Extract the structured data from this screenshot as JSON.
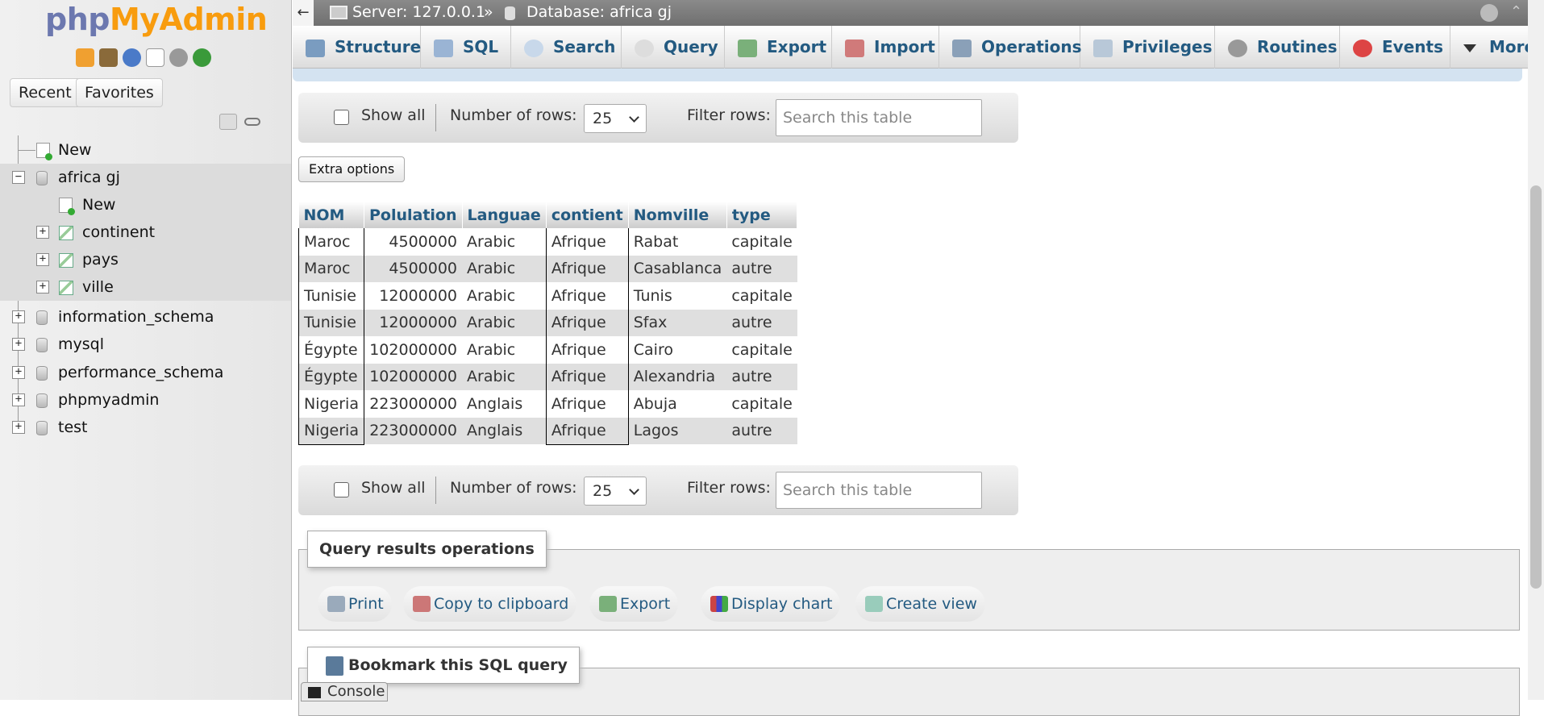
{
  "sidebar": {
    "logo_php": "php",
    "logo_myadmin": "MyAdmin",
    "nav_icons": [
      "home-icon",
      "exit-icon",
      "help-icon",
      "docs-icon",
      "settings-icon",
      "reload-icon"
    ],
    "tabs": {
      "recent": "Recent",
      "favorites": "Favorites"
    },
    "tree": {
      "new_root": "New",
      "db_active": "africa gj",
      "db_new": "New",
      "tables": [
        "continent",
        "pays",
        "ville"
      ],
      "databases": [
        "information_schema",
        "mysql",
        "performance_schema",
        "phpmyadmin",
        "test"
      ]
    }
  },
  "topbar": {
    "back": "←",
    "server_label": "Server: 127.0.0.1",
    "separator": "»",
    "database_label": "Database: africa gj"
  },
  "menu": {
    "tabs": [
      "Structure",
      "SQL",
      "Search",
      "Query",
      "Export",
      "Import",
      "Operations",
      "Privileges",
      "Routines",
      "Events",
      "More"
    ]
  },
  "navigation": {
    "show_all": "Show all",
    "rows_label": "Number of rows:",
    "rows_value": "25",
    "filter_label": "Filter rows:",
    "filter_placeholder": "Search this table"
  },
  "extra_options": "Extra options",
  "table": {
    "columns": [
      "NOM",
      "Polulation",
      "Languae",
      "contient",
      "Nomville",
      "type"
    ],
    "rows": [
      [
        "Maroc",
        "4500000",
        "Arabic",
        "Afrique",
        "Rabat",
        "capitale"
      ],
      [
        "Maroc",
        "4500000",
        "Arabic",
        "Afrique",
        "Casablanca",
        "autre"
      ],
      [
        "Tunisie",
        "12000000",
        "Arabic",
        "Afrique",
        "Tunis",
        "capitale"
      ],
      [
        "Tunisie",
        "12000000",
        "Arabic",
        "Afrique",
        "Sfax",
        "autre"
      ],
      [
        "Égypte",
        "102000000",
        "Arabic",
        "Afrique",
        "Cairo",
        "capitale"
      ],
      [
        "Égypte",
        "102000000",
        "Arabic",
        "Afrique",
        "Alexandria",
        "autre"
      ],
      [
        "Nigeria",
        "223000000",
        "Anglais",
        "Afrique",
        "Abuja",
        "capitale"
      ],
      [
        "Nigeria",
        "223000000",
        "Anglais",
        "Afrique",
        "Lagos",
        "autre"
      ]
    ]
  },
  "query_ops": {
    "title": "Query results operations",
    "buttons": [
      "Print",
      "Copy to clipboard",
      "Export",
      "Display chart",
      "Create view"
    ]
  },
  "bookmark": {
    "title": "Bookmark this SQL query"
  },
  "console": {
    "label": "Console"
  },
  "colors": {
    "link": "#235a81",
    "brand_php": "#6c78af",
    "brand_myadmin": "#f89c0e"
  }
}
